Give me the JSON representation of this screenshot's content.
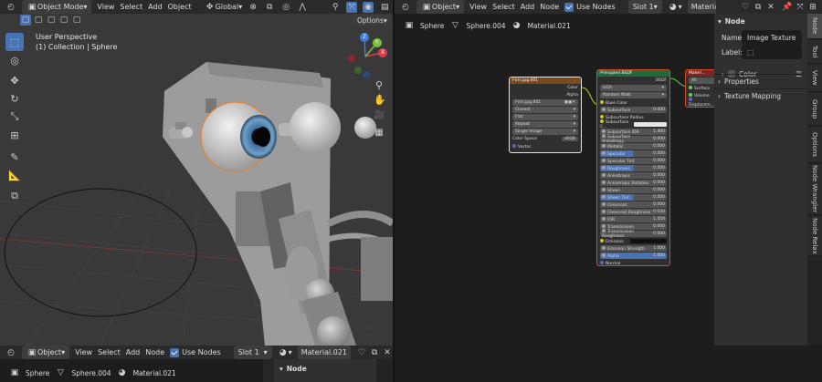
{
  "viewport": {
    "mode": "Object Mode",
    "menus": [
      "View",
      "Select",
      "Add",
      "Object"
    ],
    "transform_orientation": "Global",
    "options_label": "Options",
    "title": "User Perspective",
    "collection": "(1) Collection | Sphere",
    "gizmo_axes": {
      "x": "X",
      "y": "Y",
      "z": "Z"
    }
  },
  "node_editor_top": {
    "editor_type": "Object",
    "menus": [
      "View",
      "Select",
      "Add",
      "Node"
    ],
    "use_nodes_label": "Use Nodes",
    "slot": "Slot 1",
    "material": "Material.021",
    "breadcrumb": [
      "Sphere",
      "Sphere.004",
      "Material.021"
    ]
  },
  "nodes": {
    "image_texture": {
      "title": "f-iris.jpg.001",
      "out_color": "Color",
      "out_alpha": "Alpha",
      "image_name": "f-iris.jpg.001",
      "options": [
        "Closest",
        "Flat",
        "Repeat",
        "Single Image"
      ],
      "color_space_label": "Color Space",
      "color_space_value": "sRGB",
      "vector": "Vector"
    },
    "bsdf": {
      "title": "Principled BSDF",
      "out": "BSDF",
      "distribution": "GGX",
      "subsurface_method": "Random Walk",
      "inputs": [
        {
          "label": "Base Color",
          "value": ""
        },
        {
          "label": "Subsurface",
          "value": "0.000"
        },
        {
          "label": "Subsurface Radius",
          "value": ""
        },
        {
          "label": "Subsurface C...",
          "value": ""
        },
        {
          "label": "Subsurface IOR",
          "value": "1.400"
        },
        {
          "label": "Subsurface Anisotropy",
          "value": "0.000"
        },
        {
          "label": "Metallic",
          "value": "0.000"
        },
        {
          "label": "Specular",
          "value": "0.500"
        },
        {
          "label": "Specular Tint",
          "value": "0.000"
        },
        {
          "label": "Roughness",
          "value": "0.500"
        },
        {
          "label": "Anisotropic",
          "value": "0.000"
        },
        {
          "label": "Anisotropic Rotation",
          "value": "0.000"
        },
        {
          "label": "Sheen",
          "value": "0.000"
        },
        {
          "label": "Sheen Tint",
          "value": "0.500"
        },
        {
          "label": "Clearcoat",
          "value": "0.000"
        },
        {
          "label": "Clearcoat Roughness",
          "value": "0.030"
        },
        {
          "label": "IOR",
          "value": "1.450"
        },
        {
          "label": "Transmission",
          "value": "0.000"
        },
        {
          "label": "Transmission Roughness",
          "value": "0.000"
        },
        {
          "label": "Emission",
          "value": ""
        },
        {
          "label": "Emission Strength",
          "value": "1.000"
        },
        {
          "label": "Alpha",
          "value": "1.000"
        },
        {
          "label": "Normal",
          "value": ""
        },
        {
          "label": "Clearcoat Normal",
          "value": ""
        },
        {
          "label": "Tangent",
          "value": ""
        }
      ]
    },
    "output": {
      "title": "Materi...",
      "target": "All",
      "inputs": [
        "Surface",
        "Volume",
        "Displacem..."
      ]
    }
  },
  "sidebar": {
    "panel_title": "Node",
    "name_label": "Name:",
    "name_value": "Image Texture",
    "label_label": "Label:",
    "color_label": "Color",
    "properties_label": "Properties",
    "texture_mapping_label": "Texture Mapping",
    "tabs": [
      "Node",
      "Tool",
      "View",
      "Group",
      "Options",
      "Node Wrangler",
      "Node Relax"
    ]
  },
  "bottom": {
    "editor_type": "Object",
    "menus": [
      "View",
      "Select",
      "Add",
      "Node"
    ],
    "use_nodes_label": "Use Nodes",
    "slot": "Slot 1",
    "material": "Material.021",
    "breadcrumb": [
      "Sphere",
      "Sphere.004",
      "Material.021"
    ],
    "panel_title": "Node"
  },
  "colors": {
    "accent": "#4772b3",
    "selection": "#e8822a",
    "node_texture_header": "#7a4a1e",
    "node_shader_header": "#1f6b3a",
    "node_output_header": "#7a2424",
    "link_yellow": "#c7c729",
    "link_grey": "#a0a0a0"
  }
}
